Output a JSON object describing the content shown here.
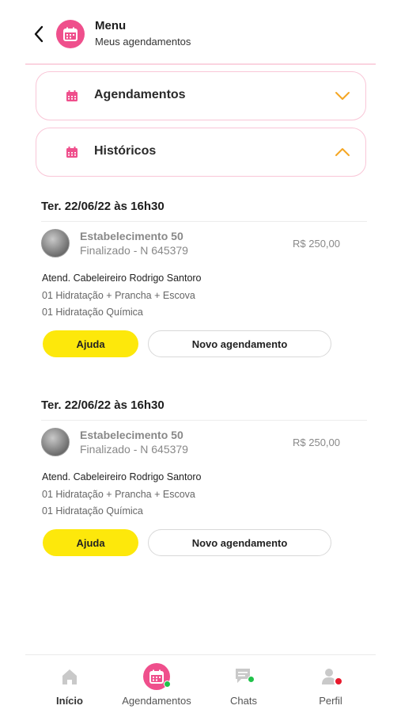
{
  "header": {
    "title": "Menu",
    "subtitle": "Meus agendamentos"
  },
  "accordions": [
    {
      "label": "Agendamentos",
      "expanded": false
    },
    {
      "label": "Históricos",
      "expanded": true
    }
  ],
  "history": [
    {
      "date": "Ter. 22/06/22 às 16h30",
      "establishment": "Estabelecimento 50",
      "status": "Finalizado - N 645379",
      "price": "R$ 250,00",
      "attendant": "Atend. Cabeleireiro Rodrigo Santoro",
      "services": [
        "01 Hidratação + Prancha + Escova",
        "01 Hidratação Química"
      ],
      "help_label": "Ajuda",
      "new_label": "Novo agendamento"
    },
    {
      "date": "Ter. 22/06/22 às 16h30",
      "establishment": "Estabelecimento 50",
      "status": "Finalizado - N 645379",
      "price": "R$ 250,00",
      "attendant": "Atend. Cabeleireiro Rodrigo Santoro",
      "services": [
        "01 Hidratação + Prancha + Escova",
        "01 Hidratação Química"
      ],
      "help_label": "Ajuda",
      "new_label": "Novo agendamento"
    }
  ],
  "bottom_nav": [
    {
      "label": "Início",
      "icon": "home-icon",
      "active": true
    },
    {
      "label": "Agendamentos",
      "icon": "calendar-icon",
      "active": false
    },
    {
      "label": "Chats",
      "icon": "chat-icon",
      "active": false
    },
    {
      "label": "Perfil",
      "icon": "user-icon",
      "active": false
    }
  ],
  "colors": {
    "accent_pink": "#ef4f8c",
    "accent_yellow": "#fde80b",
    "chevron_orange": "#f5a623",
    "online_green": "#21c24a",
    "alert_red": "#e8192c"
  }
}
